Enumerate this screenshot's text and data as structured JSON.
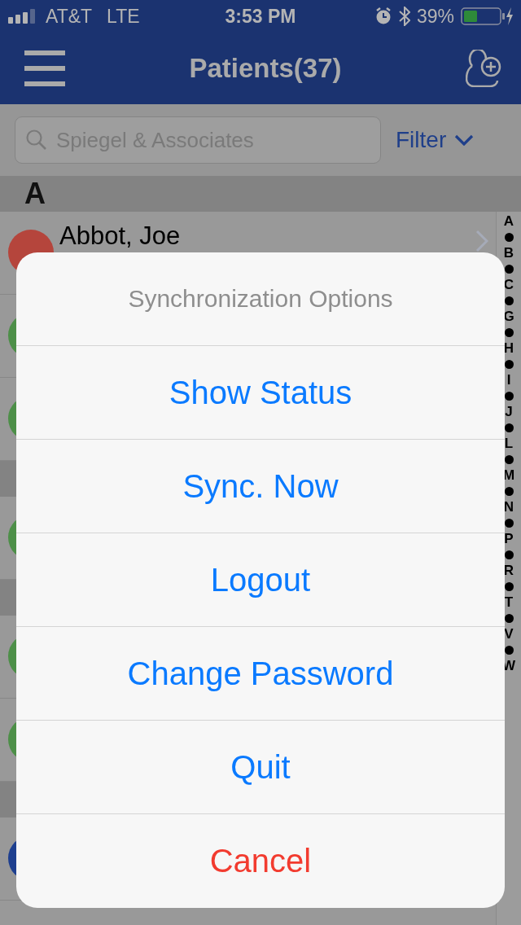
{
  "status_bar": {
    "carrier": "AT&T",
    "network": "LTE",
    "time": "3:53 PM",
    "battery": "39%"
  },
  "nav_bar": {
    "title": "Patients(37)"
  },
  "search": {
    "placeholder": "Spiegel & Associates"
  },
  "filter": {
    "label": "Filter"
  },
  "list": [
    {
      "kind": "section",
      "label": "A"
    },
    {
      "kind": "patient",
      "name": "Abbot, Joe",
      "color": "#b5453c"
    },
    {
      "kind": "patient",
      "color": "#4d8f48"
    },
    {
      "kind": "patient",
      "color": "#4d8f48"
    },
    {
      "kind": "section"
    },
    {
      "kind": "patient",
      "color": "#4d8f48"
    },
    {
      "kind": "section"
    },
    {
      "kind": "patient",
      "color": "#4d8f48"
    },
    {
      "kind": "patient",
      "color": "#4d8f48"
    },
    {
      "kind": "section"
    },
    {
      "kind": "patient",
      "color": "#1e3f8f"
    }
  ],
  "index": [
    "A",
    "B",
    "C",
    "G",
    "H",
    "I",
    "J",
    "L",
    "M",
    "N",
    "P",
    "R",
    "T",
    "V",
    "W"
  ],
  "action_sheet": {
    "title": "Synchronization Options",
    "actions": [
      {
        "label": "Show Status",
        "kind": "default"
      },
      {
        "label": "Sync. Now",
        "kind": "default"
      },
      {
        "label": "Logout",
        "kind": "default"
      },
      {
        "label": "Change Password",
        "kind": "default"
      },
      {
        "label": "Quit",
        "kind": "default"
      },
      {
        "label": "Cancel",
        "kind": "cancel"
      }
    ]
  }
}
